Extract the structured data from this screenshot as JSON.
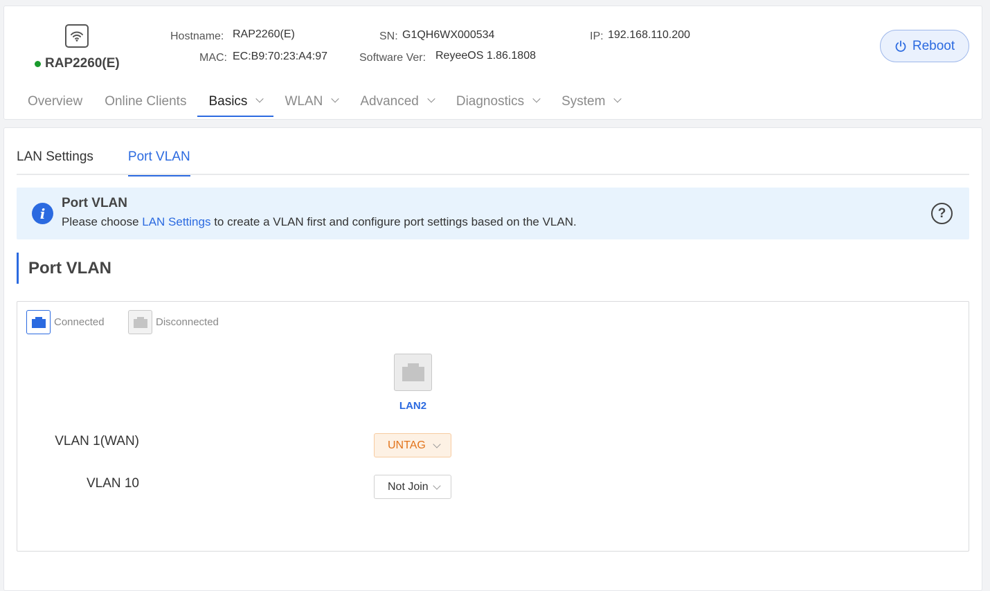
{
  "device": {
    "name": "RAP2260(E)",
    "status_color": "#1a9a2c",
    "icon": "wifi-icon"
  },
  "info": {
    "hostname_label": "Hostname:",
    "hostname_value": "RAP2260(E)",
    "mac_label": "MAC:",
    "mac_value": "EC:B9:70:23:A4:97",
    "sn_label": "SN:",
    "sn_value": "G1QH6WX000534",
    "software_label": "Software Ver:",
    "software_value": "ReyeeOS 1.86.1808",
    "ip_label": "IP:",
    "ip_value": "192.168.110.200"
  },
  "reboot": {
    "label": "Reboot",
    "icon": "power-icon"
  },
  "nav": {
    "items": [
      {
        "label": "Overview"
      },
      {
        "label": "Online Clients"
      },
      {
        "label": "Basics"
      },
      {
        "label": "WLAN"
      },
      {
        "label": "Advanced"
      },
      {
        "label": "Diagnostics"
      },
      {
        "label": "System"
      }
    ],
    "active": "Basics"
  },
  "sub_tabs": {
    "items": [
      {
        "label": "LAN Settings"
      },
      {
        "label": "Port VLAN"
      }
    ],
    "active": "Port VLAN"
  },
  "banner": {
    "title": "Port VLAN",
    "text_before": "Please choose ",
    "link": "LAN Settings",
    "text_after": " to create a VLAN first and configure port settings based on the VLAN."
  },
  "section": {
    "title": "Port VLAN"
  },
  "legend": {
    "connected": "Connected",
    "disconnected": "Disconnected"
  },
  "ports": [
    {
      "label": "LAN2",
      "status": "disconnected"
    }
  ],
  "vlans": [
    {
      "label": "VLAN 1(WAN)",
      "value": "UNTAG"
    },
    {
      "label": "VLAN 10",
      "value": "Not Join"
    }
  ],
  "colors": {
    "accent": "#2b6ae0",
    "untag": "#e2731a"
  }
}
